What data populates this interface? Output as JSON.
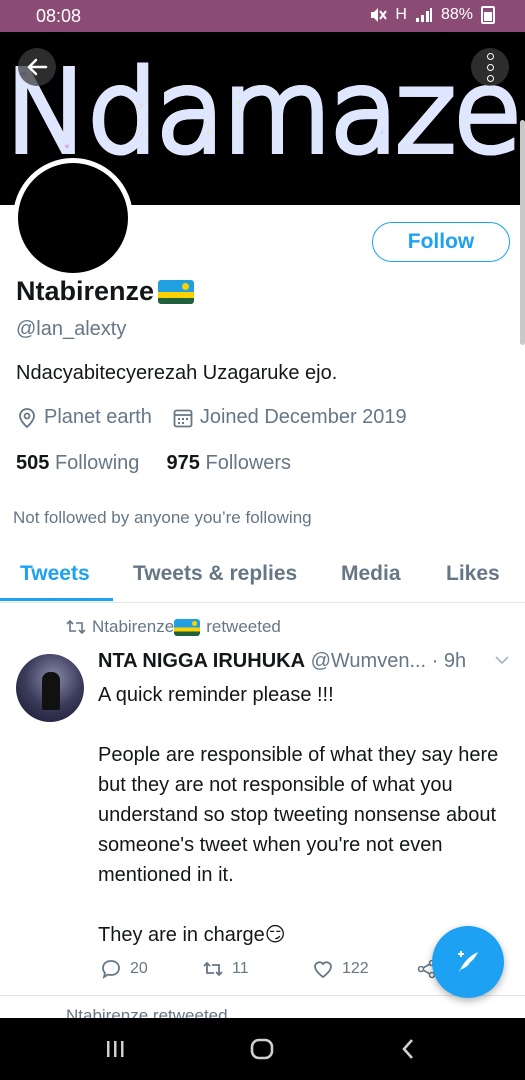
{
  "status_bar": {
    "time": "08:08",
    "network": "H",
    "battery": "88%"
  },
  "banner": {
    "text": "Ndamaze"
  },
  "profile": {
    "display_name": "Ntabirenze",
    "handle": "@lan_alexty",
    "bio": "Ndacyabitecyerezah Uzagaruke ejo.",
    "location": "Planet earth",
    "joined": "Joined December 2019",
    "following_count": "505",
    "following_label": "Following",
    "followers_count": "975",
    "followers_label": "Followers",
    "follow_label": "Follow",
    "not_followed_text": "Not followed by anyone you’re following"
  },
  "tabs": [
    {
      "label": "Tweets",
      "active": true
    },
    {
      "label": "Tweets & replies",
      "active": false
    },
    {
      "label": "Media",
      "active": false
    },
    {
      "label": "Likes",
      "active": false
    }
  ],
  "tweet": {
    "retweeter": "Ntabirenze",
    "retweeted_label": "retweeted",
    "author_name": "NTA NIGGA IRUHUKA",
    "author_handle": "@Wumven...",
    "time": "· 9h",
    "paragraphs": [
      "A quick reminder please !!!",
      "People are responsible of what they say here but they are not responsible of what you understand so stop tweeting nonsense about someone's tweet when you're not even mentioned in it.",
      "They are in charge😏"
    ],
    "replies": "20",
    "retweets": "11",
    "likes": "122"
  },
  "next_tweet": {
    "retweet_text": "Ntabirenze retweeted"
  },
  "colors": {
    "accent": "#1da1f2",
    "muted": "#657786",
    "status_bar": "#8a4c74"
  }
}
